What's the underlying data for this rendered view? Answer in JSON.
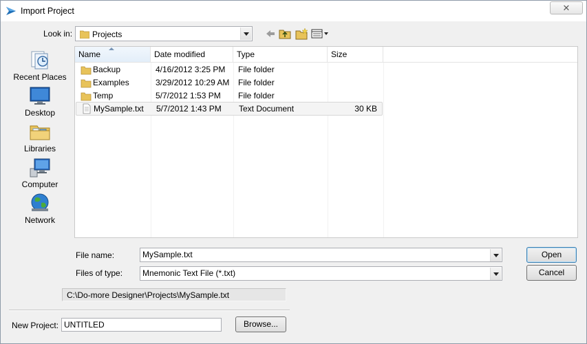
{
  "window": {
    "title": "Import Project",
    "close_label": "✕"
  },
  "lookin": {
    "label": "Look in:",
    "value": "Projects"
  },
  "places": [
    {
      "label": "Recent Places",
      "icon": "recent-places-icon"
    },
    {
      "label": "Desktop",
      "icon": "desktop-icon"
    },
    {
      "label": "Libraries",
      "icon": "libraries-icon"
    },
    {
      "label": "Computer",
      "icon": "computer-icon"
    },
    {
      "label": "Network",
      "icon": "network-icon"
    }
  ],
  "filelist": {
    "columns": [
      "Name",
      "Date modified",
      "Type",
      "Size"
    ],
    "rows": [
      {
        "name": "Backup",
        "date": "4/16/2012 3:25 PM",
        "type": "File folder",
        "size": "",
        "icon": "folder-icon"
      },
      {
        "name": "Examples",
        "date": "3/29/2012 10:29 AM",
        "type": "File folder",
        "size": "",
        "icon": "folder-icon"
      },
      {
        "name": "Temp",
        "date": "5/7/2012 1:53 PM",
        "type": "File folder",
        "size": "",
        "icon": "folder-icon"
      },
      {
        "name": "MySample.txt",
        "date": "5/7/2012 1:43 PM",
        "type": "Text Document",
        "size": "30 KB",
        "icon": "text-document-icon"
      }
    ]
  },
  "filename": {
    "label": "File name:",
    "value": "MySample.txt"
  },
  "filetype": {
    "label": "Files of type:",
    "value": "Mnemonic Text File (*.txt)"
  },
  "buttons": {
    "open": "Open",
    "cancel": "Cancel",
    "browse": "Browse..."
  },
  "path": "C:\\Do-more Designer\\Projects\\MySample.txt",
  "new_project": {
    "label": "New Project:",
    "value": "UNTITLED"
  },
  "colors": {
    "folder": "#e8c35a",
    "title_arrow": "#1f6fb7",
    "selection_border": "#d6d6d6"
  }
}
